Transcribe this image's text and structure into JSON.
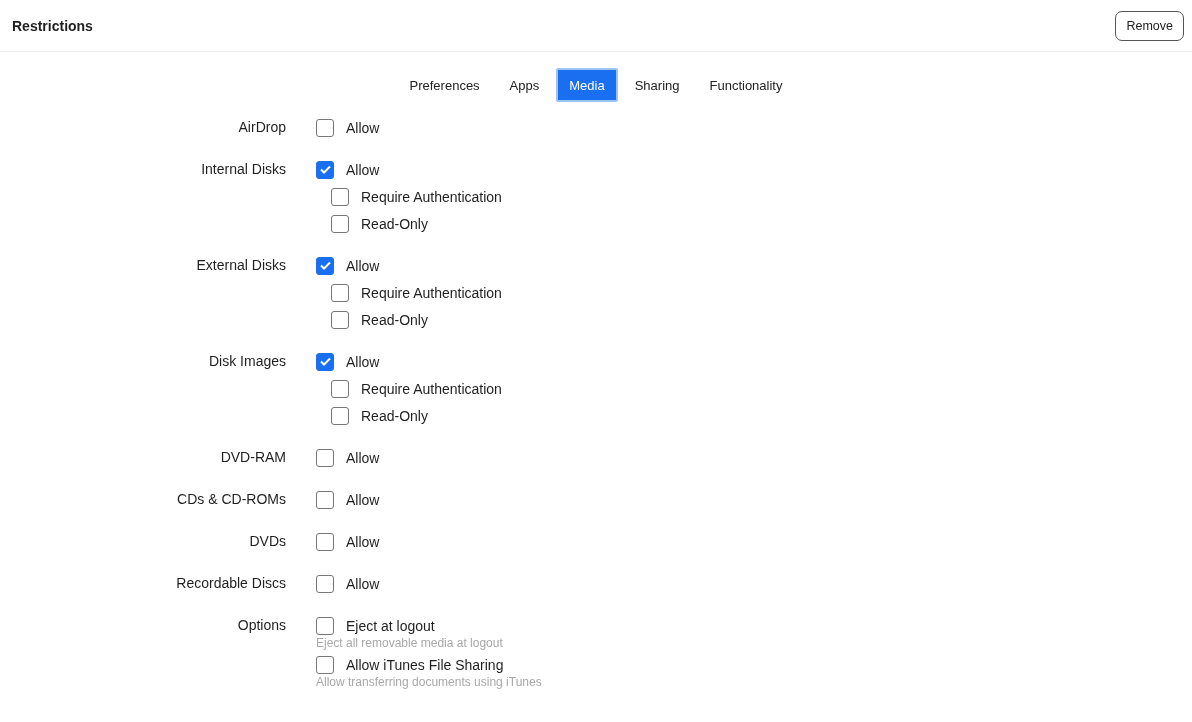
{
  "header": {
    "title": "Restrictions",
    "button": "Remove"
  },
  "tabs": [
    {
      "label": "Preferences",
      "selected": false
    },
    {
      "label": "Apps",
      "selected": false
    },
    {
      "label": "Media",
      "selected": true
    },
    {
      "label": "Sharing",
      "selected": false
    },
    {
      "label": "Functionality",
      "selected": false
    }
  ],
  "sections": [
    {
      "label": "AirDrop",
      "options": [
        {
          "label": "Allow",
          "checked": false
        }
      ]
    },
    {
      "label": "Internal Disks",
      "options": [
        {
          "label": "Allow",
          "checked": true,
          "children": [
            {
              "label": "Require Authentication",
              "checked": false
            },
            {
              "label": "Read-Only",
              "checked": false
            }
          ]
        }
      ]
    },
    {
      "label": "External Disks",
      "options": [
        {
          "label": "Allow",
          "checked": true,
          "children": [
            {
              "label": "Require Authentication",
              "checked": false
            },
            {
              "label": "Read-Only",
              "checked": false
            }
          ]
        }
      ]
    },
    {
      "label": "Disk Images",
      "options": [
        {
          "label": "Allow",
          "checked": true,
          "children": [
            {
              "label": "Require Authentication",
              "checked": false
            },
            {
              "label": "Read-Only",
              "checked": false
            }
          ]
        }
      ]
    },
    {
      "label": "DVD-RAM",
      "options": [
        {
          "label": "Allow",
          "checked": false
        }
      ]
    },
    {
      "label": "CDs & CD-ROMs",
      "options": [
        {
          "label": "Allow",
          "checked": false
        }
      ]
    },
    {
      "label": "DVDs",
      "options": [
        {
          "label": "Allow",
          "checked": false
        }
      ]
    },
    {
      "label": "Recordable Discs",
      "options": [
        {
          "label": "Allow",
          "checked": false
        }
      ]
    },
    {
      "label": "Options",
      "options": [
        {
          "label": "Eject at logout",
          "checked": false,
          "hint": "Eject all removable media at logout"
        },
        {
          "label": "Allow iTunes File Sharing",
          "checked": false,
          "hint": "Allow transferring documents using iTunes"
        }
      ]
    }
  ]
}
